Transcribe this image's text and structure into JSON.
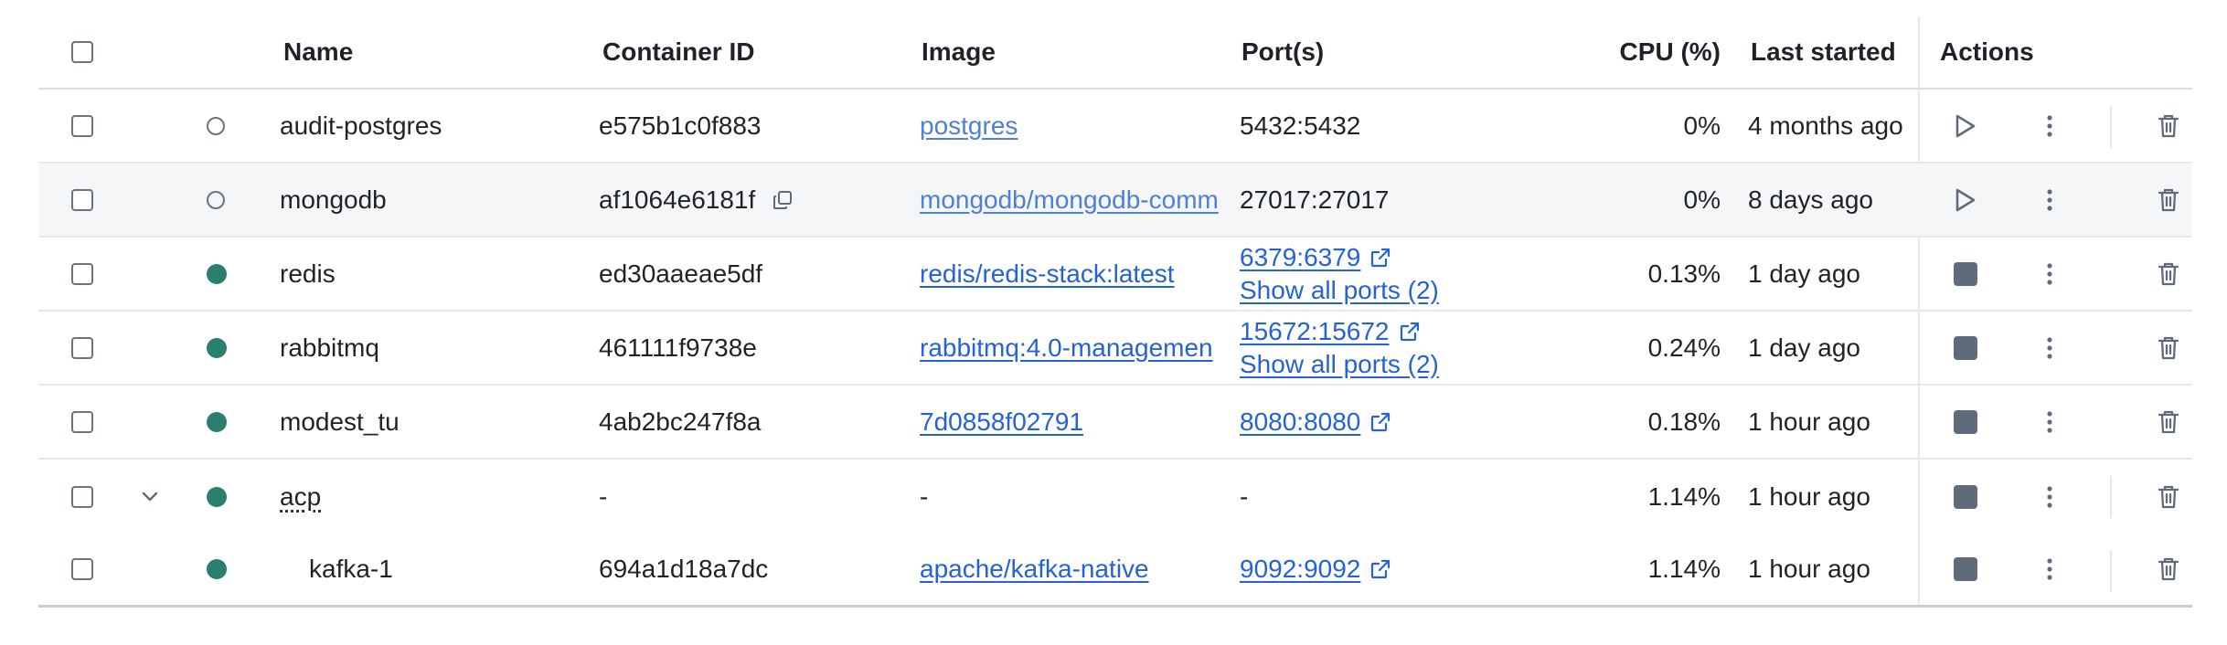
{
  "header": {
    "name": "Name",
    "container_id": "Container ID",
    "image": "Image",
    "ports": "Port(s)",
    "cpu": "CPU (%)",
    "last_started": "Last started",
    "actions": "Actions"
  },
  "rows": [
    {
      "name": "audit-postgres",
      "container_id": "e575b1c0f883",
      "image": "postgres",
      "ports": "5432:5432",
      "show_all_ports": "",
      "cpu": "0%",
      "last_started": "4 months ago",
      "status": "stopped"
    },
    {
      "name": "mongodb",
      "container_id": "af1064e6181f",
      "image": "mongodb/mongodb-comm",
      "ports": "27017:27017",
      "show_all_ports": "",
      "cpu": "0%",
      "last_started": "8 days ago",
      "status": "stopped"
    },
    {
      "name": "redis",
      "container_id": "ed30aaeae5df",
      "image": "redis/redis-stack:latest",
      "ports": "6379:6379",
      "show_all_ports": "Show all ports (2)",
      "cpu": "0.13%",
      "last_started": "1 day ago",
      "status": "running"
    },
    {
      "name": "rabbitmq",
      "container_id": "461111f9738e",
      "image": "rabbitmq:4.0-managemen",
      "ports": "15672:15672",
      "show_all_ports": "Show all ports (2)",
      "cpu": "0.24%",
      "last_started": "1 day ago",
      "status": "running"
    },
    {
      "name": "modest_tu",
      "container_id": "4ab2bc247f8a",
      "image": "7d0858f02791",
      "ports": "8080:8080",
      "show_all_ports": "",
      "cpu": "0.18%",
      "last_started": "1 hour ago",
      "status": "running"
    },
    {
      "name": "acp",
      "container_id": "-",
      "image": "-",
      "ports": "-",
      "show_all_ports": "",
      "cpu": "1.14%",
      "last_started": "1 hour ago",
      "status": "running"
    },
    {
      "name": "kafka-1",
      "container_id": "694a1d18a7dc",
      "image": "apache/kafka-native",
      "ports": "9092:9092",
      "show_all_ports": "",
      "cpu": "1.14%",
      "last_started": "1 hour ago",
      "status": "running"
    }
  ],
  "icons": {
    "start": "play-icon",
    "stop": "stop-icon",
    "more": "more-vertical-icon",
    "delete": "trash-icon",
    "copy": "copy-icon",
    "external": "external-link-icon",
    "expand": "chevron-down-icon"
  },
  "colors": {
    "running": "#2a7f6f",
    "link": "#2462d6",
    "icon": "#5f6b7a"
  }
}
